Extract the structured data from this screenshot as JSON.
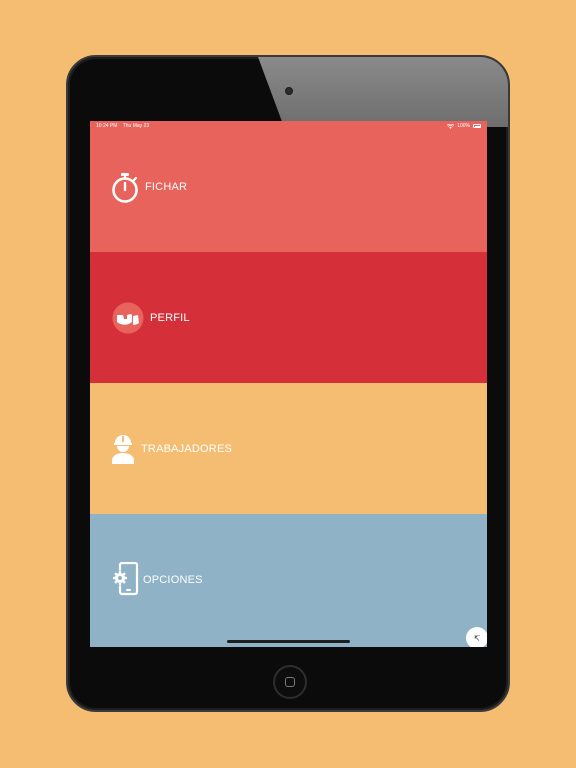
{
  "status_bar": {
    "time": "10:24 PM",
    "date": "Thu May 23",
    "battery": "100%"
  },
  "menu": {
    "items": [
      {
        "label": "FICHAR",
        "icon": "stopwatch-icon",
        "color": "#E8635C"
      },
      {
        "label": "PERFIL",
        "icon": "profile-icon",
        "color": "#D52F3A"
      },
      {
        "label": "TRABAJADORES",
        "icon": "worker-hardhat-icon",
        "color": "#F5BD72"
      },
      {
        "label": "OPCIONES",
        "icon": "phone-settings-icon",
        "color": "#8FB2C6"
      }
    ]
  },
  "colors": {
    "background": "#F5BD72"
  },
  "corner_button": {
    "icon": "expand-arrow-icon",
    "glyph": "↸"
  }
}
